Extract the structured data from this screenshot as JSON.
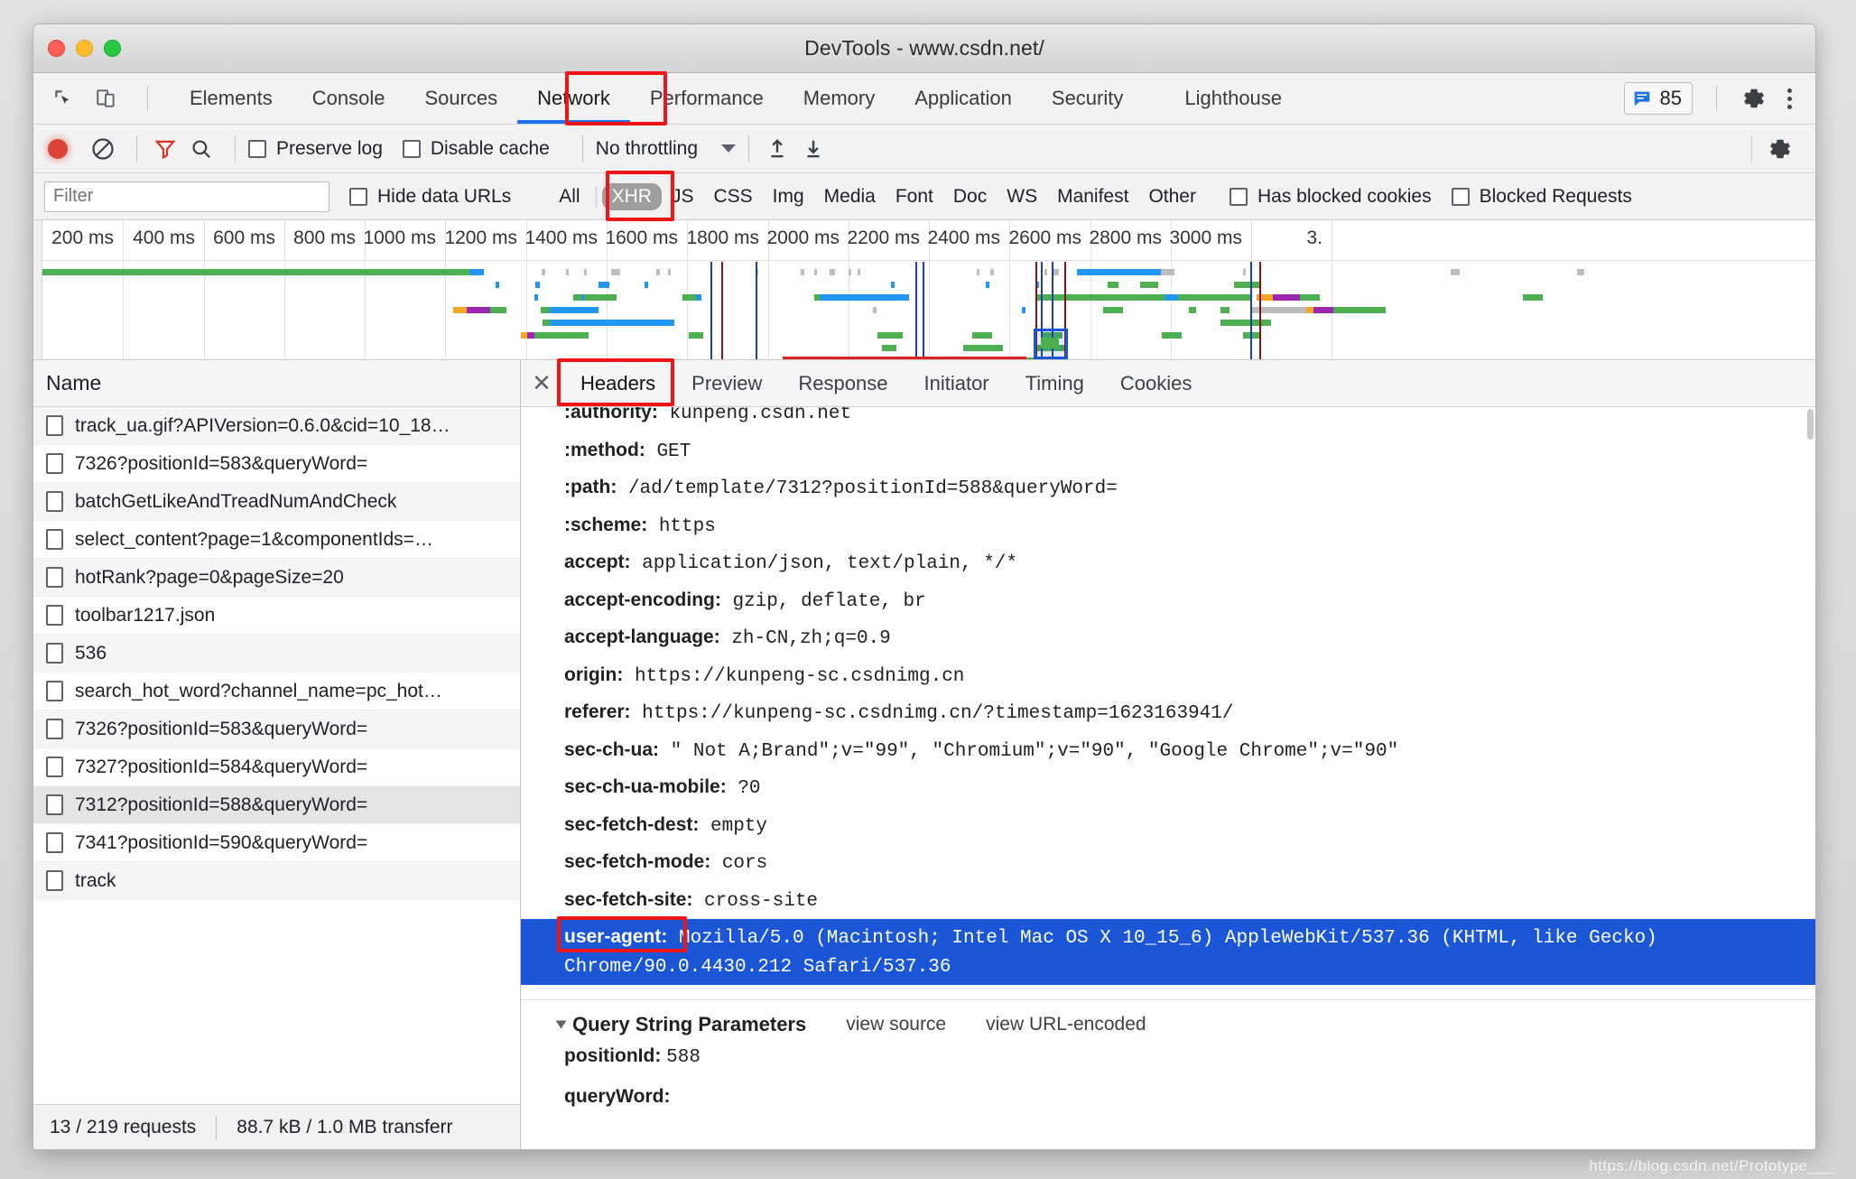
{
  "window": {
    "title": "DevTools - www.csdn.net/"
  },
  "devtools_tabs": {
    "items": [
      {
        "label": "Elements",
        "active": false
      },
      {
        "label": "Console",
        "active": false
      },
      {
        "label": "Sources",
        "active": false
      },
      {
        "label": "Network",
        "active": true
      },
      {
        "label": "Performance",
        "active": false
      },
      {
        "label": "Memory",
        "active": false
      },
      {
        "label": "Application",
        "active": false
      },
      {
        "label": "Security",
        "active": false
      },
      {
        "label": "Lighthouse",
        "active": false
      }
    ],
    "issues_count": "85"
  },
  "network_toolbar": {
    "preserve_log": "Preserve log",
    "disable_cache": "Disable cache",
    "throttling": "No throttling"
  },
  "filter_bar": {
    "filter_placeholder": "Filter",
    "filter_value": "",
    "hide_data_urls": "Hide data URLs",
    "types": [
      {
        "label": "All",
        "selected": false
      },
      {
        "label": "XHR",
        "selected": true
      },
      {
        "label": "JS",
        "selected": false
      },
      {
        "label": "CSS",
        "selected": false
      },
      {
        "label": "Img",
        "selected": false
      },
      {
        "label": "Media",
        "selected": false
      },
      {
        "label": "Font",
        "selected": false
      },
      {
        "label": "Doc",
        "selected": false
      },
      {
        "label": "WS",
        "selected": false
      },
      {
        "label": "Manifest",
        "selected": false
      },
      {
        "label": "Other",
        "selected": false
      }
    ],
    "has_blocked_cookies": "Has blocked cookies",
    "blocked_requests": "Blocked Requests"
  },
  "overview": {
    "ticks": [
      "200 ms",
      "400 ms",
      "600 ms",
      "800 ms",
      "1000 ms",
      "1200 ms",
      "1400 ms",
      "1600 ms",
      "1800 ms",
      "2000 ms",
      "2200 ms",
      "2400 ms",
      "2600 ms",
      "2800 ms",
      "3000 ms",
      "3."
    ]
  },
  "requests": {
    "column_header": "Name",
    "rows": [
      {
        "name": "track_ua.gif?APIVersion=0.6.0&cid=10_18…",
        "selected": false
      },
      {
        "name": "7326?positionId=583&queryWord=",
        "selected": false
      },
      {
        "name": "batchGetLikeAndTreadNumAndCheck",
        "selected": false
      },
      {
        "name": "select_content?page=1&componentIds=…",
        "selected": false
      },
      {
        "name": "hotRank?page=0&pageSize=20",
        "selected": false
      },
      {
        "name": "toolbar1217.json",
        "selected": false
      },
      {
        "name": "536",
        "selected": false
      },
      {
        "name": "search_hot_word?channel_name=pc_hot…",
        "selected": false
      },
      {
        "name": "7326?positionId=583&queryWord=",
        "selected": false
      },
      {
        "name": "7327?positionId=584&queryWord=",
        "selected": false
      },
      {
        "name": "7312?positionId=588&queryWord=",
        "selected": true
      },
      {
        "name": "7341?positionId=590&queryWord=",
        "selected": false
      },
      {
        "name": "track",
        "selected": false
      }
    ],
    "status_requests": "13 / 219 requests",
    "status_transferred": "88.7 kB / 1.0 MB transferr"
  },
  "details": {
    "tabs": [
      {
        "label": "Headers",
        "active": true
      },
      {
        "label": "Preview",
        "active": false
      },
      {
        "label": "Response",
        "active": false
      },
      {
        "label": "Initiator",
        "active": false
      },
      {
        "label": "Timing",
        "active": false
      },
      {
        "label": "Cookies",
        "active": false
      }
    ],
    "headers": [
      {
        "key": ":authority:",
        "value": "kunpeng.csdn.net",
        "highlight": false,
        "clipped": true
      },
      {
        "key": ":method:",
        "value": "GET",
        "highlight": false
      },
      {
        "key": ":path:",
        "value": "/ad/template/7312?positionId=588&queryWord=",
        "highlight": false
      },
      {
        "key": ":scheme:",
        "value": "https",
        "highlight": false
      },
      {
        "key": "accept:",
        "value": "application/json, text/plain, */*",
        "highlight": false
      },
      {
        "key": "accept-encoding:",
        "value": "gzip, deflate, br",
        "highlight": false
      },
      {
        "key": "accept-language:",
        "value": "zh-CN,zh;q=0.9",
        "highlight": false
      },
      {
        "key": "origin:",
        "value": "https://kunpeng-sc.csdnimg.cn",
        "highlight": false
      },
      {
        "key": "referer:",
        "value": "https://kunpeng-sc.csdnimg.cn/?timestamp=1623163941/",
        "highlight": false
      },
      {
        "key": "sec-ch-ua:",
        "value": "\" Not A;Brand\";v=\"99\", \"Chromium\";v=\"90\", \"Google Chrome\";v=\"90\"",
        "highlight": false
      },
      {
        "key": "sec-ch-ua-mobile:",
        "value": "?0",
        "highlight": false
      },
      {
        "key": "sec-fetch-dest:",
        "value": "empty",
        "highlight": false
      },
      {
        "key": "sec-fetch-mode:",
        "value": "cors",
        "highlight": false
      },
      {
        "key": "sec-fetch-site:",
        "value": "cross-site",
        "highlight": false
      },
      {
        "key": "user-agent:",
        "value": "Mozilla/5.0 (Macintosh; Intel Mac OS X 10_15_6) AppleWebKit/537.36 (KHTML, like Gecko) Chrome/90.0.4430.212 Safari/537.36",
        "highlight": true
      }
    ],
    "query_string": {
      "title": "Query String Parameters",
      "view_source": "view source",
      "view_url_encoded": "view URL-encoded",
      "params": [
        {
          "key": "positionId:",
          "value": "588"
        },
        {
          "key": "queryWord:",
          "value": ""
        }
      ]
    }
  },
  "watermark": "https://blog.csdn.net/Prototype___",
  "colors": {
    "accent_blue": "#1a73e8",
    "highlight_blue": "#1a56d6",
    "annotation_red": "#f01414",
    "record_red": "#db4437",
    "bar_green": "#4caf50",
    "bar_blue": "#2196f3",
    "bar_orange": "#f5a623",
    "bar_purple": "#9c27b0",
    "bar_gray": "#bdbdbd"
  }
}
